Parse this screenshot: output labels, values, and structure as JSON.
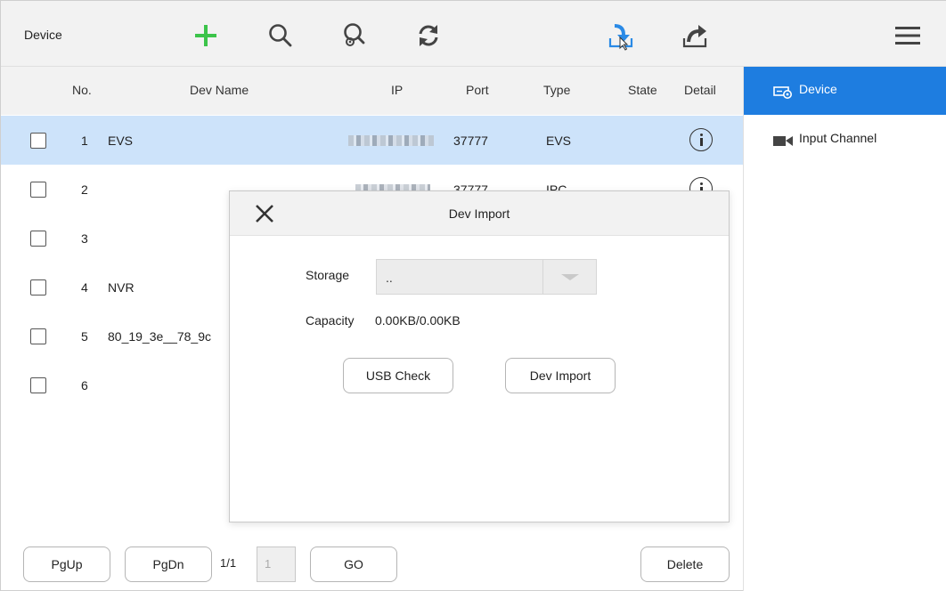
{
  "toolbar": {
    "title": "Device",
    "icons": [
      "add-icon",
      "search-icon",
      "smart-search-icon",
      "refresh-icon",
      "import-icon",
      "export-icon",
      "menu-icon"
    ]
  },
  "table": {
    "headers": {
      "no": "No.",
      "dev_name": "Dev Name",
      "ip": "IP",
      "port": "Port",
      "type": "Type",
      "state": "State",
      "detail": "Detail"
    },
    "rows": [
      {
        "no": "1",
        "name": "EVS",
        "port": "37777",
        "type": "EVS",
        "selected": true
      },
      {
        "no": "2",
        "name": "",
        "port": "37777",
        "type": "IPC",
        "selected": false
      },
      {
        "no": "3",
        "name": "",
        "port": "",
        "type": "",
        "selected": false
      },
      {
        "no": "4",
        "name": "NVR",
        "port": "",
        "type": "",
        "selected": false
      },
      {
        "no": "5",
        "name": "80_19_3e__78_9c",
        "port": "",
        "type": "",
        "selected": false
      },
      {
        "no": "6",
        "name": "",
        "port": "",
        "type": "",
        "selected": false
      }
    ]
  },
  "sidebar": {
    "items": [
      {
        "label": "Device",
        "icon": "device-icon",
        "active": true
      },
      {
        "label": "Input Channel",
        "icon": "camera-icon",
        "active": false
      }
    ]
  },
  "footer": {
    "pgup": "PgUp",
    "pgdn": "PgDn",
    "page_info": "1/1",
    "page_input": "1",
    "go": "GO",
    "delete": "Delete"
  },
  "modal": {
    "title": "Dev Import",
    "storage_label": "Storage",
    "storage_value": "..",
    "capacity_label": "Capacity",
    "capacity_value": "0.00KB/0.00KB",
    "usb_check": "USB Check",
    "dev_import": "Dev Import"
  },
  "colors": {
    "accent": "#1e7de0",
    "selected_row": "#cde3fa",
    "add_green": "#3cc44a",
    "import_blue": "#2a8ae6"
  }
}
